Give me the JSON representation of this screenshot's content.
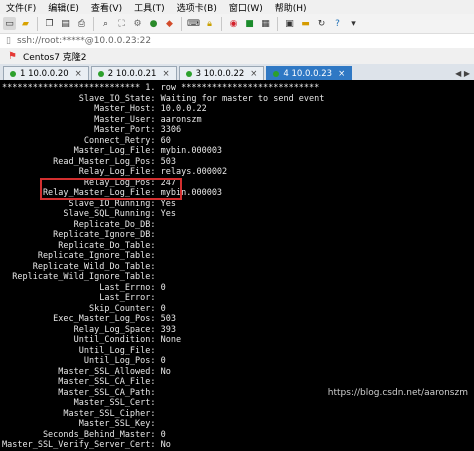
{
  "menu": {
    "items": [
      "文件(F)",
      "编辑(E)",
      "查看(V)",
      "工具(T)",
      "选项卡(B)",
      "窗口(W)",
      "帮助(H)"
    ]
  },
  "address": {
    "value": "ssh://root:*****@10.0.0.23:22"
  },
  "favorites": {
    "label": "Centos7 克隆2"
  },
  "tabs": [
    {
      "label": "1 10.0.0.20",
      "active": false
    },
    {
      "label": "2 10.0.0.21",
      "active": false
    },
    {
      "label": "3 10.0.0.22",
      "active": false
    },
    {
      "label": "4 10.0.0.23",
      "active": true
    }
  ],
  "terminal": {
    "lines": [
      "*************************** 1. row ***************************",
      "               Slave_IO_State: Waiting for master to send event",
      "                  Master_Host: 10.0.0.22",
      "                  Master_User: aaronszm",
      "                  Master_Port: 3306",
      "                Connect_Retry: 60",
      "              Master_Log_File: mybin.000003",
      "          Read_Master_Log_Pos: 503",
      "               Relay_Log_File: relays.000002",
      "                Relay_Log_Pos: 247",
      "        Relay_Master_Log_File: mybin.000003",
      "             Slave_IO_Running: Yes",
      "            Slave_SQL_Running: Yes",
      "              Replicate_Do_DB:",
      "          Replicate_Ignore_DB:",
      "           Replicate_Do_Table:",
      "       Replicate_Ignore_Table:",
      "      Replicate_Wild_Do_Table:",
      "  Replicate_Wild_Ignore_Table:",
      "                   Last_Errno: 0",
      "                   Last_Error:",
      "                 Skip_Counter: 0",
      "          Exec_Master_Log_Pos: 503",
      "              Relay_Log_Space: 393",
      "              Until_Condition: None",
      "               Until_Log_File:",
      "                Until_Log_Pos: 0",
      "           Master_SSL_Allowed: No",
      "           Master_SSL_CA_File:",
      "           Master_SSL_CA_Path:",
      "              Master_SSL_Cert:",
      "            Master_SSL_Cipher:",
      "               Master_SSL_Key:",
      "        Seconds_Behind_Master: 0",
      "Master_SSL_Verify_Server_Cert: No"
    ]
  },
  "watermark": "https://blog.csdn.net/aaronszm",
  "colors": {
    "highlight_border": "#d32f2f",
    "active_tab": "#2f78c4"
  }
}
